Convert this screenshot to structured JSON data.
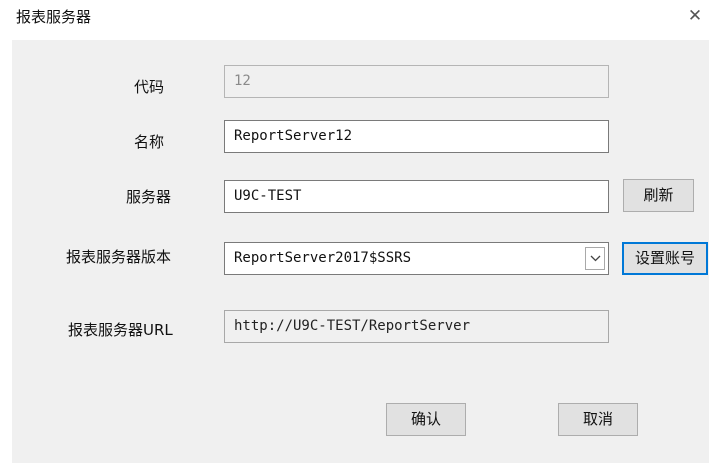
{
  "window": {
    "title": "报表服务器",
    "close_glyph": "✕"
  },
  "form": {
    "code": {
      "label": "代码",
      "value": "12"
    },
    "name": {
      "label": "名称",
      "value": "ReportServer12"
    },
    "server": {
      "label": "服务器",
      "value": "U9C-TEST",
      "refresh_label": "刷新"
    },
    "version": {
      "label": "报表服务器版本",
      "selected": "ReportServer2017$SSRS",
      "set_account_label": "设置账号"
    },
    "url": {
      "label": "报表服务器URL",
      "value": "http://U9C-TEST/ReportServer"
    }
  },
  "footer": {
    "confirm_label": "确认",
    "cancel_label": "取消"
  },
  "icons": {
    "close": "close-icon",
    "dropdown": "chevron-down-icon"
  }
}
